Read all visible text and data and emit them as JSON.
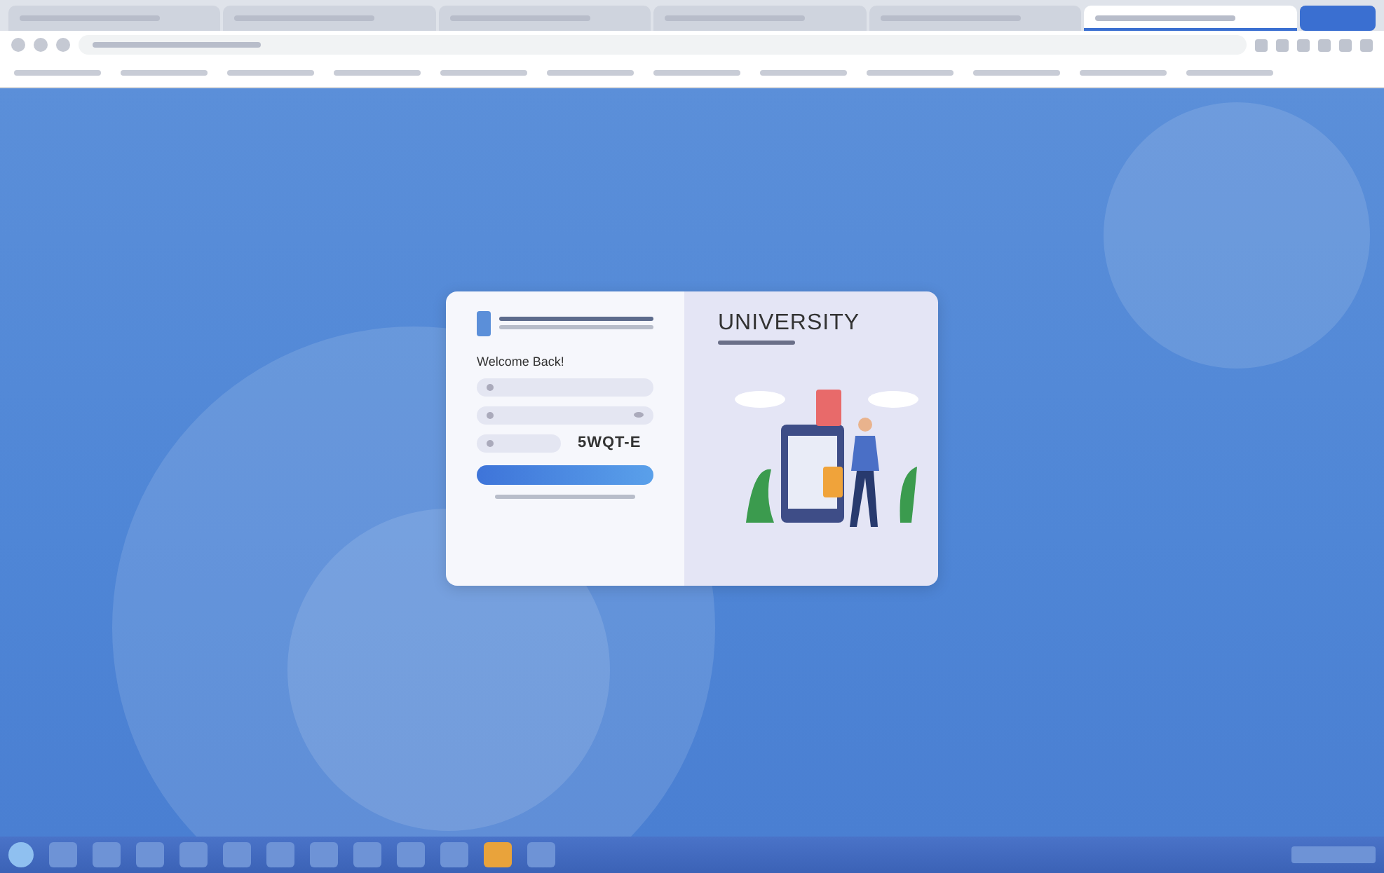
{
  "browser": {
    "tabs": [
      {
        "selected": false
      },
      {
        "selected": false
      },
      {
        "selected": false
      },
      {
        "selected": false
      },
      {
        "selected": false
      },
      {
        "selected": true
      }
    ]
  },
  "login": {
    "welcome": "Welcome Back!",
    "fields": [
      {
        "kind": "user"
      },
      {
        "kind": "password"
      }
    ],
    "captcha": "5WQT-E",
    "title": "UNIVERSITY"
  },
  "taskbar": {
    "apps": [
      {
        "selected": false
      },
      {
        "selected": false
      },
      {
        "selected": false
      },
      {
        "selected": false
      },
      {
        "selected": false
      },
      {
        "selected": false
      },
      {
        "selected": false
      },
      {
        "selected": false
      },
      {
        "selected": false
      },
      {
        "selected": false
      },
      {
        "selected": true
      },
      {
        "selected": false
      }
    ]
  }
}
